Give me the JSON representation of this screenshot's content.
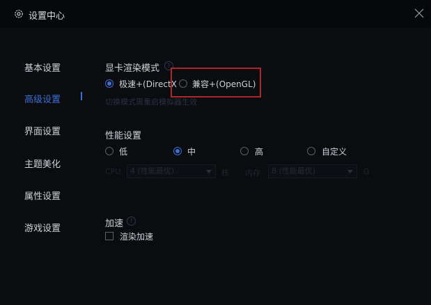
{
  "window": {
    "title": "设置中心"
  },
  "sidebar": {
    "items": [
      {
        "label": "基本设置"
      },
      {
        "label": "高级设置"
      },
      {
        "label": "界面设置"
      },
      {
        "label": "主题美化"
      },
      {
        "label": "属性设置"
      },
      {
        "label": "游戏设置"
      }
    ],
    "active_index": 1
  },
  "render_mode": {
    "title": "显卡渲染模式",
    "options": [
      {
        "label": "极速+(DirectX",
        "checked": true
      },
      {
        "label": "兼容+(OpenGL)",
        "checked": false
      }
    ],
    "hint": "切换模式需重启模拟器生效"
  },
  "performance": {
    "title": "性能设置",
    "options": [
      {
        "label": "低",
        "checked": false
      },
      {
        "label": "中",
        "checked": true
      },
      {
        "label": "高",
        "checked": false
      },
      {
        "label": "自定义",
        "checked": false
      }
    ],
    "custom": {
      "cpu_label": "CPU",
      "cpu_value": "4 (性能最优)",
      "cpu_unit": "核",
      "mem_label": "内存",
      "mem_value": "8 (性能最优)",
      "mem_unit": "G"
    }
  },
  "acceleration": {
    "title": "加速",
    "checkbox_label": "渲染加速",
    "checked": false
  },
  "colors": {
    "accent": "#3d6fd6",
    "highlight": "#b0262a",
    "background": "#0b0c10"
  }
}
